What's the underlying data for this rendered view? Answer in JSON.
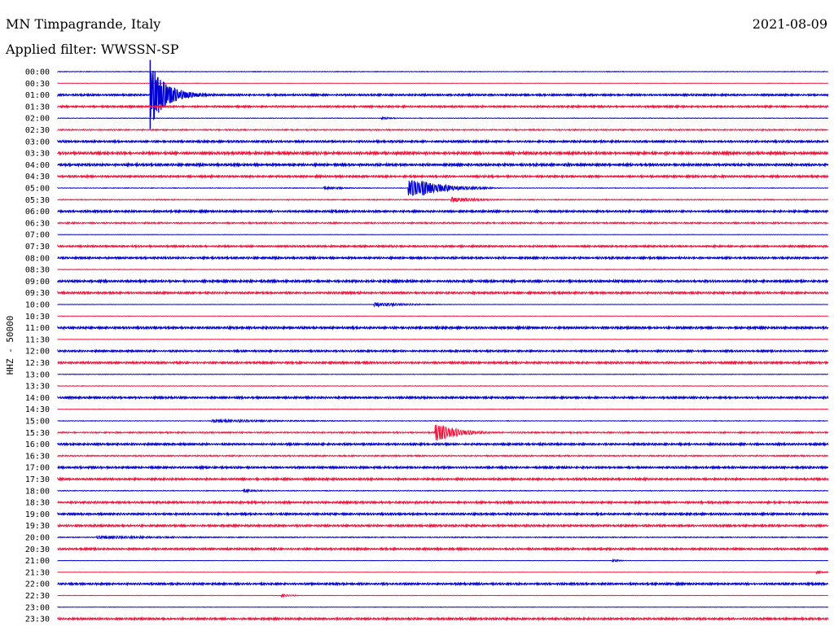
{
  "header": {
    "station": "MN Timpagrande, Italy",
    "date": "2021-08-09",
    "filter": "Applied filter: WWSSN-SP"
  },
  "chart_data": {
    "type": "line",
    "title": "MN Timpagrande, Italy",
    "ylabel": "HHZ - 50000",
    "colors": [
      "#0000d0",
      "#f0143c"
    ],
    "rows": [
      {
        "label": "00:00",
        "color": 0,
        "noise": 0.3
      },
      {
        "label": "00:30",
        "color": 1,
        "noise": 0.15
      },
      {
        "label": "01:00",
        "color": 0,
        "noise": 0.9
      },
      {
        "label": "01:30",
        "color": 1,
        "noise": 0.9
      },
      {
        "label": "02:00",
        "color": 0,
        "noise": 0.3
      },
      {
        "label": "02:30",
        "color": 1,
        "noise": 0.7
      },
      {
        "label": "03:00",
        "color": 0,
        "noise": 1.0
      },
      {
        "label": "03:30",
        "color": 1,
        "noise": 1.3
      },
      {
        "label": "04:00",
        "color": 0,
        "noise": 1.2
      },
      {
        "label": "04:30",
        "color": 1,
        "noise": 1.0
      },
      {
        "label": "05:00",
        "color": 0,
        "noise": 0.3
      },
      {
        "label": "05:30",
        "color": 1,
        "noise": 0.5
      },
      {
        "label": "06:00",
        "color": 0,
        "noise": 1.0
      },
      {
        "label": "06:30",
        "color": 1,
        "noise": 0.8
      },
      {
        "label": "07:00",
        "color": 0,
        "noise": 0.2
      },
      {
        "label": "07:30",
        "color": 1,
        "noise": 0.9
      },
      {
        "label": "08:00",
        "color": 0,
        "noise": 1.0
      },
      {
        "label": "08:30",
        "color": 1,
        "noise": 0.3
      },
      {
        "label": "09:00",
        "color": 0,
        "noise": 1.1
      },
      {
        "label": "09:30",
        "color": 1,
        "noise": 1.0
      },
      {
        "label": "10:00",
        "color": 0,
        "noise": 0.2
      },
      {
        "label": "10:30",
        "color": 1,
        "noise": 0.2
      },
      {
        "label": "11:00",
        "color": 0,
        "noise": 1.1
      },
      {
        "label": "11:30",
        "color": 1,
        "noise": 0.2
      },
      {
        "label": "12:00",
        "color": 0,
        "noise": 0.9
      },
      {
        "label": "12:30",
        "color": 1,
        "noise": 1.0
      },
      {
        "label": "13:00",
        "color": 0,
        "noise": 0.3
      },
      {
        "label": "13:30",
        "color": 1,
        "noise": 0.3
      },
      {
        "label": "14:00",
        "color": 0,
        "noise": 1.0
      },
      {
        "label": "14:30",
        "color": 1,
        "noise": 0.2
      },
      {
        "label": "15:00",
        "color": 0,
        "noise": 0.3
      },
      {
        "label": "15:30",
        "color": 1,
        "noise": 0.8
      },
      {
        "label": "16:00",
        "color": 0,
        "noise": 1.0
      },
      {
        "label": "16:30",
        "color": 1,
        "noise": 0.7
      },
      {
        "label": "17:00",
        "color": 0,
        "noise": 1.0
      },
      {
        "label": "17:30",
        "color": 1,
        "noise": 1.0
      },
      {
        "label": "18:00",
        "color": 0,
        "noise": 0.4
      },
      {
        "label": "18:30",
        "color": 1,
        "noise": 1.0
      },
      {
        "label": "19:00",
        "color": 0,
        "noise": 1.0
      },
      {
        "label": "19:30",
        "color": 1,
        "noise": 1.0
      },
      {
        "label": "20:00",
        "color": 0,
        "noise": 0.5
      },
      {
        "label": "20:30",
        "color": 1,
        "noise": 1.0
      },
      {
        "label": "21:00",
        "color": 0,
        "noise": 0.2
      },
      {
        "label": "21:30",
        "color": 1,
        "noise": 0.2
      },
      {
        "label": "22:00",
        "color": 0,
        "noise": 1.0
      },
      {
        "label": "22:30",
        "color": 1,
        "noise": 0.2
      },
      {
        "label": "23:00",
        "color": 0,
        "noise": 0.2
      },
      {
        "label": "23:30",
        "color": 1,
        "noise": 1.0
      }
    ],
    "events": [
      {
        "row": 2,
        "t": 0.12,
        "amp": 38,
        "dur": 0.02,
        "spike": 1
      },
      {
        "row": 2,
        "t": 0.165,
        "amp": 4,
        "dur": 0.03
      },
      {
        "row": 4,
        "t": 0.42,
        "amp": 2,
        "dur": 0.015
      },
      {
        "row": 6,
        "t": 0.27,
        "amp": 2,
        "dur": 0.01
      },
      {
        "row": 8,
        "t": 0.66,
        "amp": 2,
        "dur": 0.02
      },
      {
        "row": 10,
        "t": 0.455,
        "amp": 14,
        "dur": 0.04
      },
      {
        "row": 10,
        "t": 0.345,
        "amp": 2,
        "dur": 0.035
      },
      {
        "row": 11,
        "t": 0.51,
        "amp": 4,
        "dur": 0.035
      },
      {
        "row": 20,
        "t": 0.41,
        "amp": 3,
        "dur": 0.045
      },
      {
        "row": 30,
        "t": 0.2,
        "amp": 2,
        "dur": 0.12
      },
      {
        "row": 31,
        "t": 0.49,
        "amp": 12,
        "dur": 0.03
      },
      {
        "row": 36,
        "t": 0.24,
        "amp": 2,
        "dur": 0.03
      },
      {
        "row": 40,
        "t": 0.05,
        "amp": 2,
        "dur": 0.13
      },
      {
        "row": 42,
        "t": 0.72,
        "amp": 2,
        "dur": 0.01
      },
      {
        "row": 43,
        "t": 0.985,
        "amp": 2,
        "dur": 0.015
      },
      {
        "row": 45,
        "t": 0.29,
        "amp": 2,
        "dur": 0.015
      }
    ]
  }
}
